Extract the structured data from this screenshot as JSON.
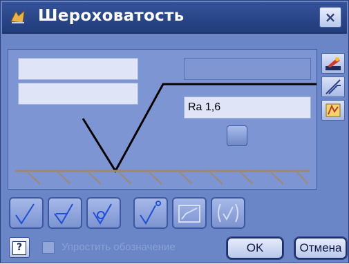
{
  "window": {
    "title": "Шероховатость",
    "close_label": "×"
  },
  "fields": {
    "top_left": "",
    "mid_left": "",
    "top_right": "",
    "roughness_value": "Ra 1,6"
  },
  "footer": {
    "help_label": "?",
    "checkbox_label": "Упростить обозначение",
    "ok_label": "OK",
    "cancel_label": "Отмена"
  },
  "colors": {
    "window_bg": "#6b86c6",
    "title_bar": "#2a4688",
    "field_bg": "#dfe4f7",
    "symbol_line": "#000000",
    "ground_line": "#a08a6e"
  },
  "tool_icons": [
    "surface-basic-icon",
    "surface-machined-icon",
    "surface-unmachined-icon",
    "surface-extended-icon",
    "surface-frame-icon",
    "surface-bracket-icon"
  ]
}
